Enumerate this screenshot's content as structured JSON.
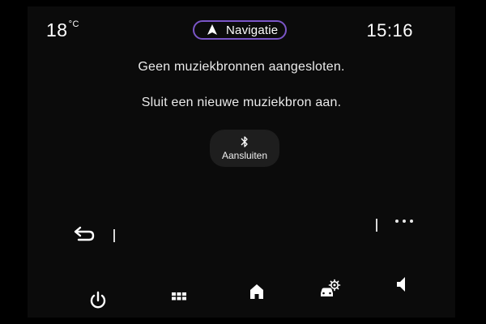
{
  "status_bar": {
    "temperature": "18",
    "temperature_unit": "°C",
    "time": "15:16"
  },
  "navigation_button": {
    "label": "Navigatie",
    "icon": "navigation-arrow-icon",
    "accent_color": "#7b56c7"
  },
  "main": {
    "message_primary": "Geen muziekbronnen aangesloten.",
    "message_secondary": "Sluit een nieuwe muziekbron aan.",
    "connect_button": {
      "label": "Aansluiten",
      "icon": "bluetooth-icon"
    }
  },
  "toolbar": {
    "back_icon": "back-arrow-icon",
    "more_icon": "more-dots-icon"
  },
  "bottom_bar": {
    "items": [
      {
        "name": "power",
        "icon": "power-icon"
      },
      {
        "name": "apps",
        "icon": "grid-icon"
      },
      {
        "name": "home",
        "icon": "home-icon"
      },
      {
        "name": "car-settings",
        "icon": "car-settings-icon"
      },
      {
        "name": "volume",
        "icon": "speaker-icon"
      }
    ]
  }
}
